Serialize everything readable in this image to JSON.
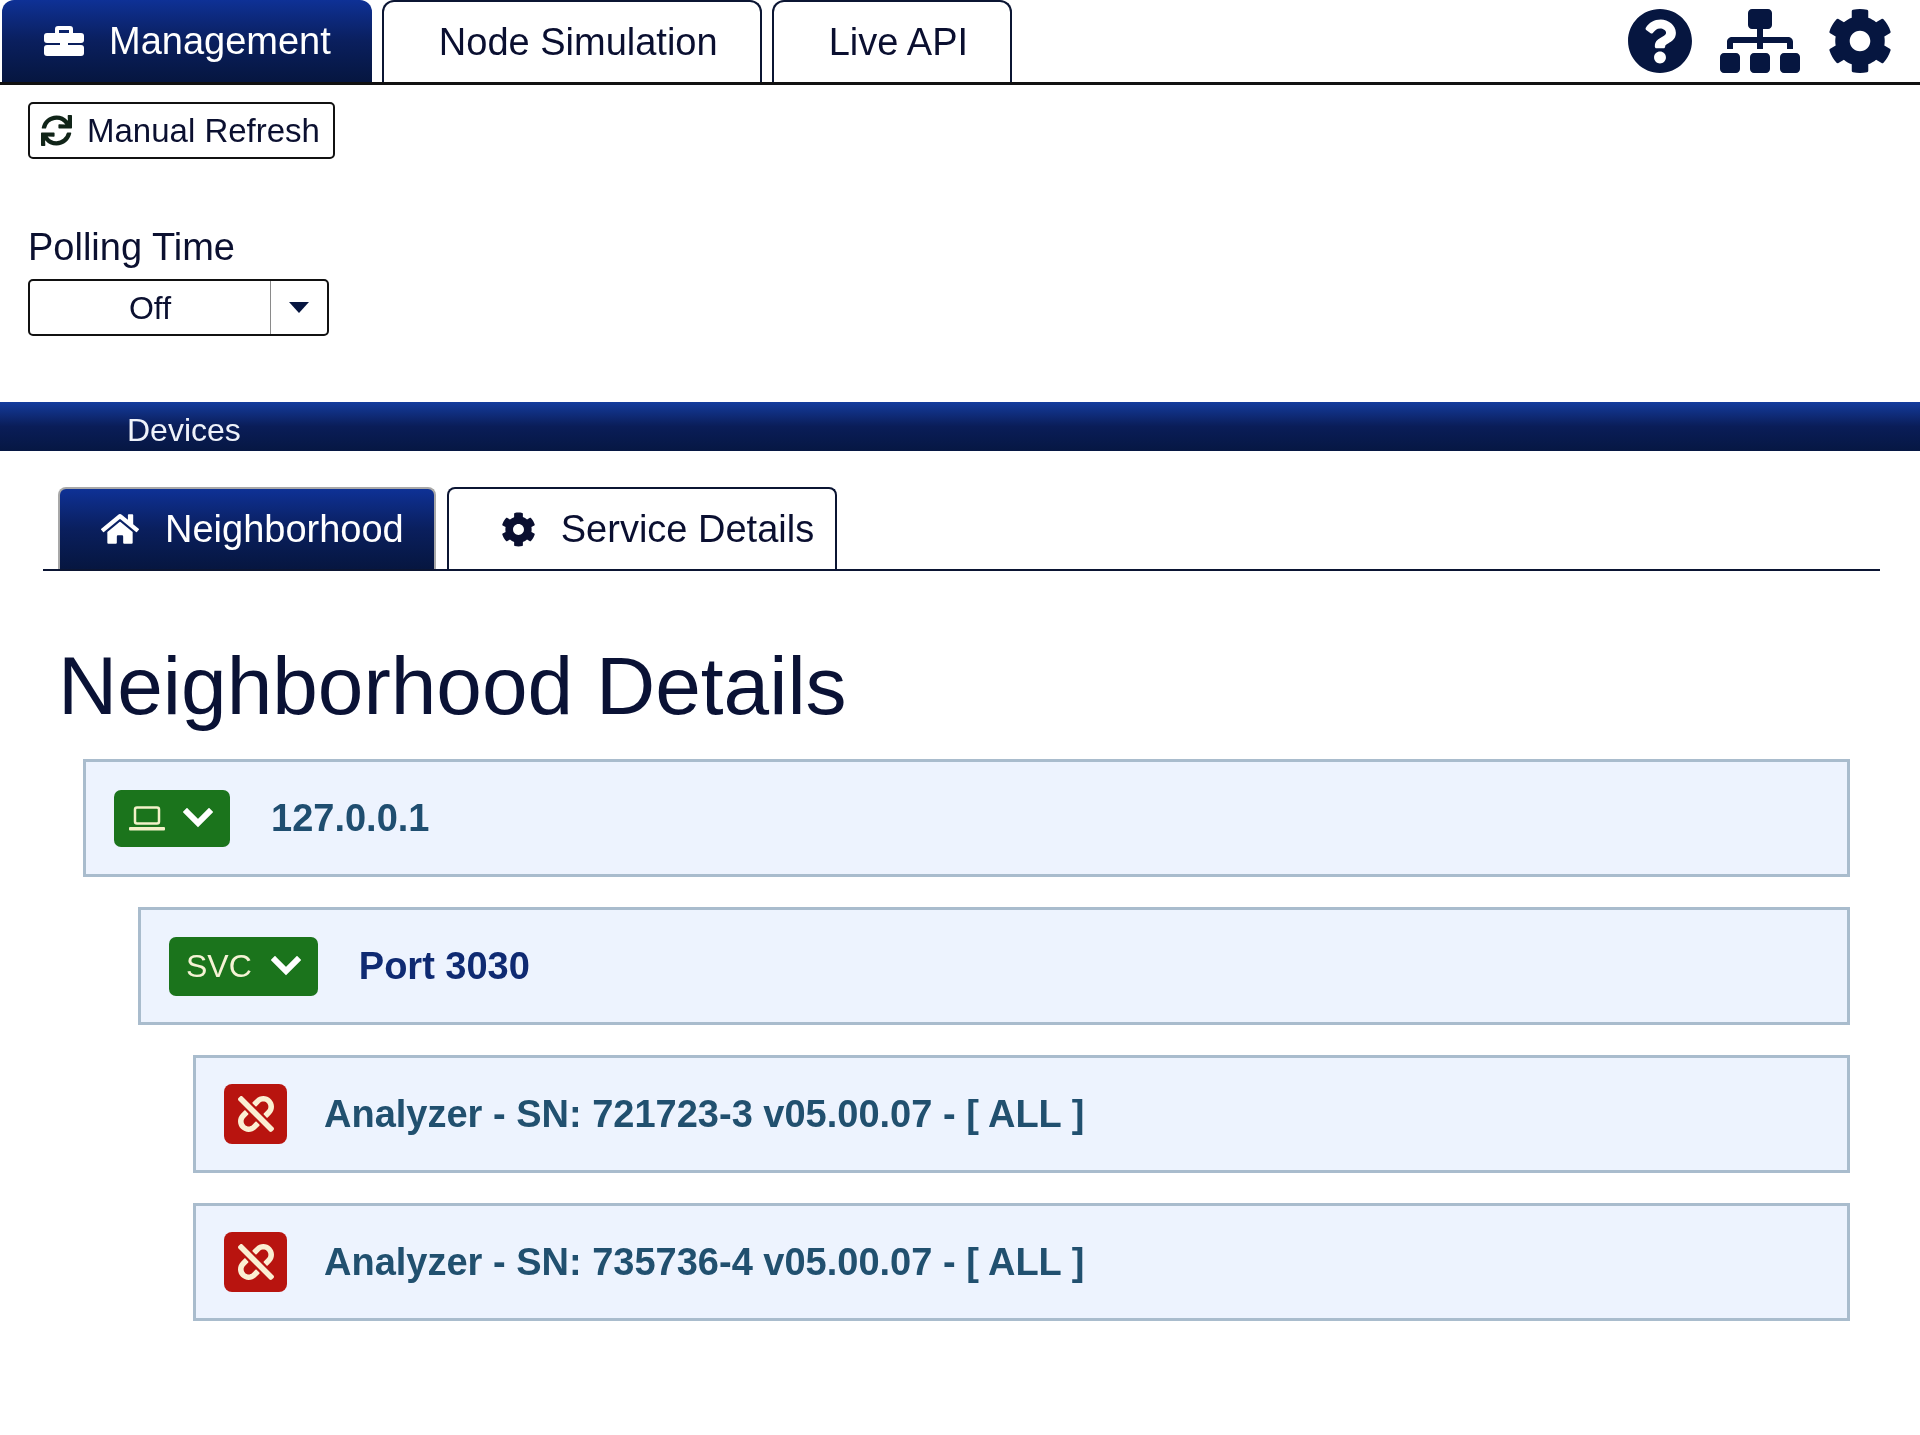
{
  "top_tabs": [
    {
      "label": "Management",
      "selected": true
    },
    {
      "label": "Node Simulation",
      "selected": false
    },
    {
      "label": "Live API",
      "selected": false
    }
  ],
  "refresh_button": {
    "label": "Manual Refresh"
  },
  "polling_time": {
    "label": "Polling Time",
    "value": "Off"
  },
  "devices_bar": {
    "title": "Devices"
  },
  "device_tabs": [
    {
      "label": "Neighborhood",
      "selected": true
    },
    {
      "label": "Service Details",
      "selected": false
    }
  ],
  "neighborhood": {
    "title": "Neighborhood Details",
    "nodes": [
      {
        "kind": "host",
        "label": "127.0.0.1",
        "expanded": true,
        "children": [
          {
            "kind": "service",
            "badge": "SVC",
            "label": "Port 3030",
            "expanded": true,
            "children": [
              {
                "kind": "device",
                "label": "Analyzer - SN: 721723-3 v05.00.07 - [ ALL ]"
              },
              {
                "kind": "device",
                "label": "Analyzer - SN: 735736-4 v05.00.07 - [ ALL ]"
              }
            ]
          }
        ]
      }
    ]
  }
}
